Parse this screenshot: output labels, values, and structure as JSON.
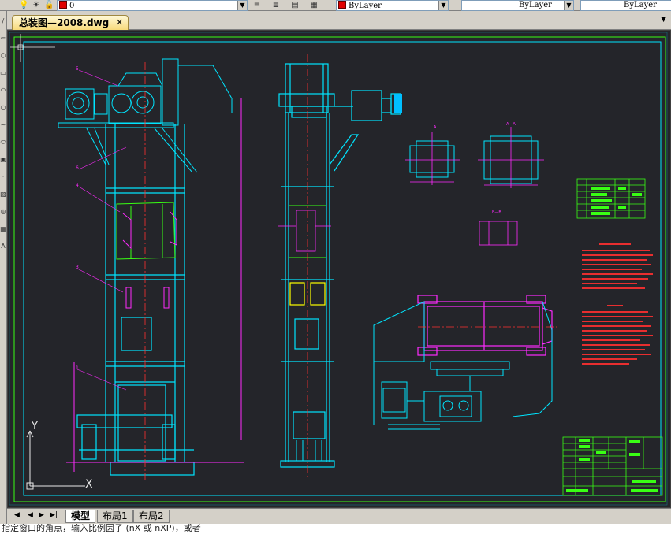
{
  "toolbar": {
    "layer_name": "0",
    "color_value": "ByLayer",
    "linetype_value": "ByLayer",
    "lineweight_value": "ByLayer",
    "layer_color": "#e00000"
  },
  "document_tab": {
    "title": "总装图—2008.dwg"
  },
  "layout_tabs": [
    "模型",
    "布局1",
    "布局2"
  ],
  "command_line": {
    "text": "指定窗口的角点，输入比例因子 (nX 或 nXP)，或者"
  },
  "ucs": {
    "x_label": "X",
    "y_label": "Y"
  },
  "colors": {
    "canvas": "#24252a",
    "cyan": "#00e5ff",
    "magenta": "#ff2bff",
    "green": "#39ff14",
    "yellow": "#ffff00",
    "red": "#ff3030",
    "white": "#e8e8e8"
  }
}
